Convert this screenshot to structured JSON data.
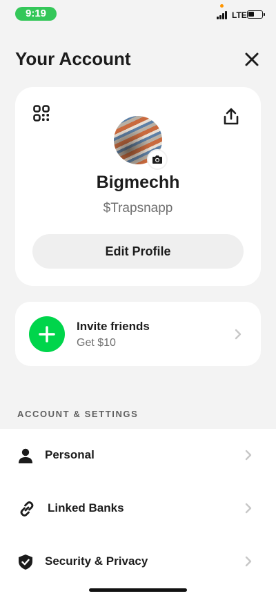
{
  "status_bar": {
    "time": "9:19",
    "network": "LTE",
    "accent_time_pill": "#34c759"
  },
  "header": {
    "title": "Your Account",
    "close_icon": "close-icon"
  },
  "profile": {
    "display_name": "Bigmechh",
    "cashtag": "$Trapsnapp",
    "edit_button_label": "Edit Profile",
    "qr_icon": "qr-code-icon",
    "share_icon": "share-icon",
    "camera_icon": "camera-icon"
  },
  "invite": {
    "title": "Invite friends",
    "subtitle": "Get $10",
    "accent": "#00d54b",
    "icon": "plus-icon"
  },
  "settings": {
    "section_label": "ACCOUNT & SETTINGS",
    "items": [
      {
        "label": "Personal",
        "icon": "person-icon"
      },
      {
        "label": "Linked Banks",
        "icon": "link-icon"
      },
      {
        "label": "Security & Privacy",
        "icon": "shield-icon"
      }
    ]
  }
}
